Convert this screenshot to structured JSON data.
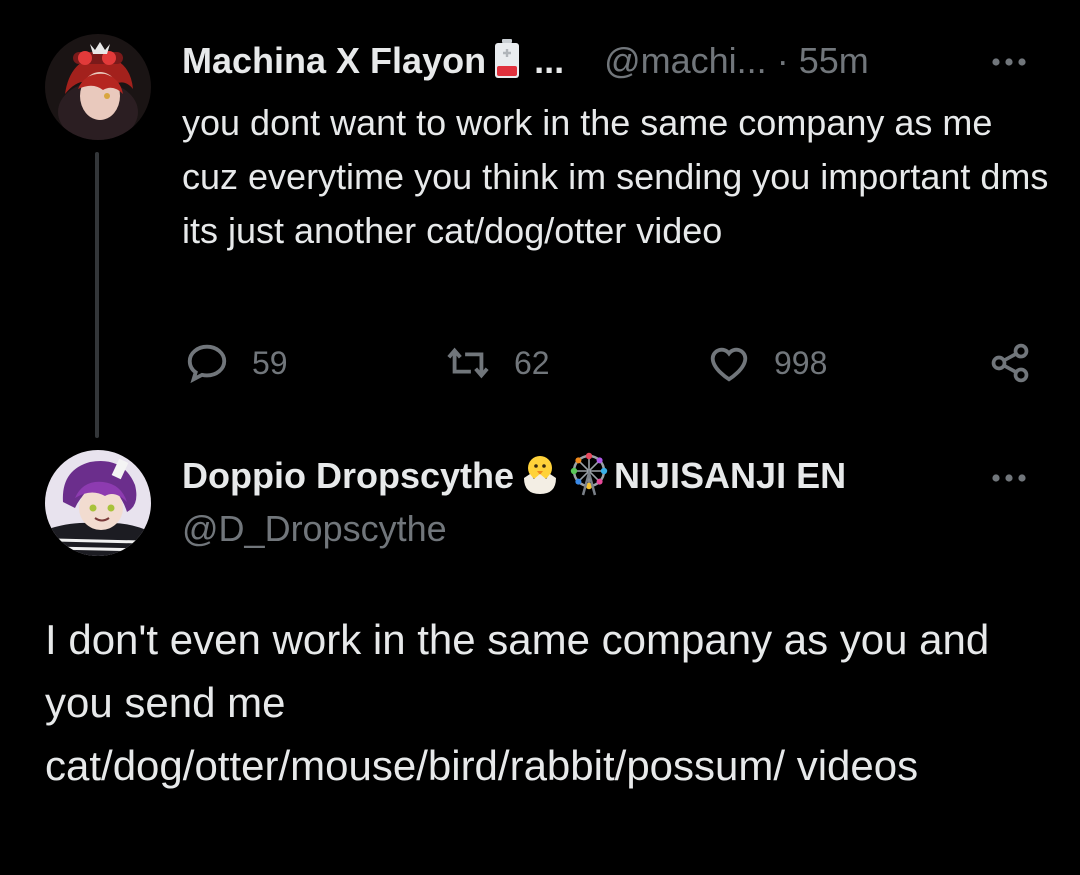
{
  "tweet1": {
    "display_name": "Machina X Flayon",
    "ellipsis": "...",
    "handle": "@machi...",
    "separator": "·",
    "time": "55m",
    "text": "you dont want to work in the same company as me cuz everytime you think im sending you important dms its just another cat/dog/otter video",
    "reply_count": "59",
    "retweet_count": "62",
    "like_count": "998",
    "name_badge_icon": "battery-icon"
  },
  "tweet2": {
    "display_name": "Doppio Dropscythe",
    "name_suffix": "NIJISANJI EN",
    "handle": "@D_Dropscythe",
    "text": "I don't even work in the same company as you and you send me cat/dog/otter/mouse/bird/rabbit/possum/ videos",
    "name_badge_icons": [
      "hatching-chick-icon",
      "ferris-wheel-icon"
    ]
  },
  "icons": {
    "more": "more-icon",
    "reply": "reply-icon",
    "retweet": "retweet-icon",
    "like": "heart-icon",
    "share": "share-icon"
  },
  "colors": {
    "background": "#000000",
    "text": "#e7e9ea",
    "muted": "#71767b",
    "thread_line": "#333639"
  }
}
